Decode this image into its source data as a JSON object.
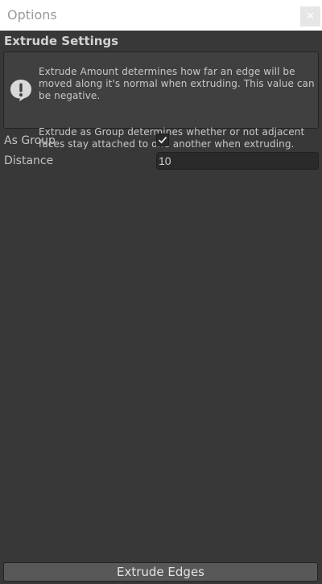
{
  "window": {
    "title": "Options",
    "close_symbol": "✕"
  },
  "section": {
    "header": "Extrude Settings"
  },
  "help": {
    "icon": "exclamation-icon",
    "paragraph_1": "Extrude Amount determines how far an edge will be moved along it's normal when extruding.  This value can be negative.",
    "paragraph_2": "Extrude as Group determines whether or not adjacent faces stay attached to one another when extruding."
  },
  "settings": {
    "as_group": {
      "label": "As Group",
      "checked": true
    },
    "distance": {
      "label": "Distance",
      "value": "10"
    }
  },
  "actions": {
    "extrude_edges_label": "Extrude Edges"
  },
  "colors": {
    "panel_bg": "#383838",
    "titlebar_bg": "#ffffff",
    "field_bg": "#2a2a2a",
    "button_bg": "#585858",
    "text": "#c4c4c4"
  }
}
